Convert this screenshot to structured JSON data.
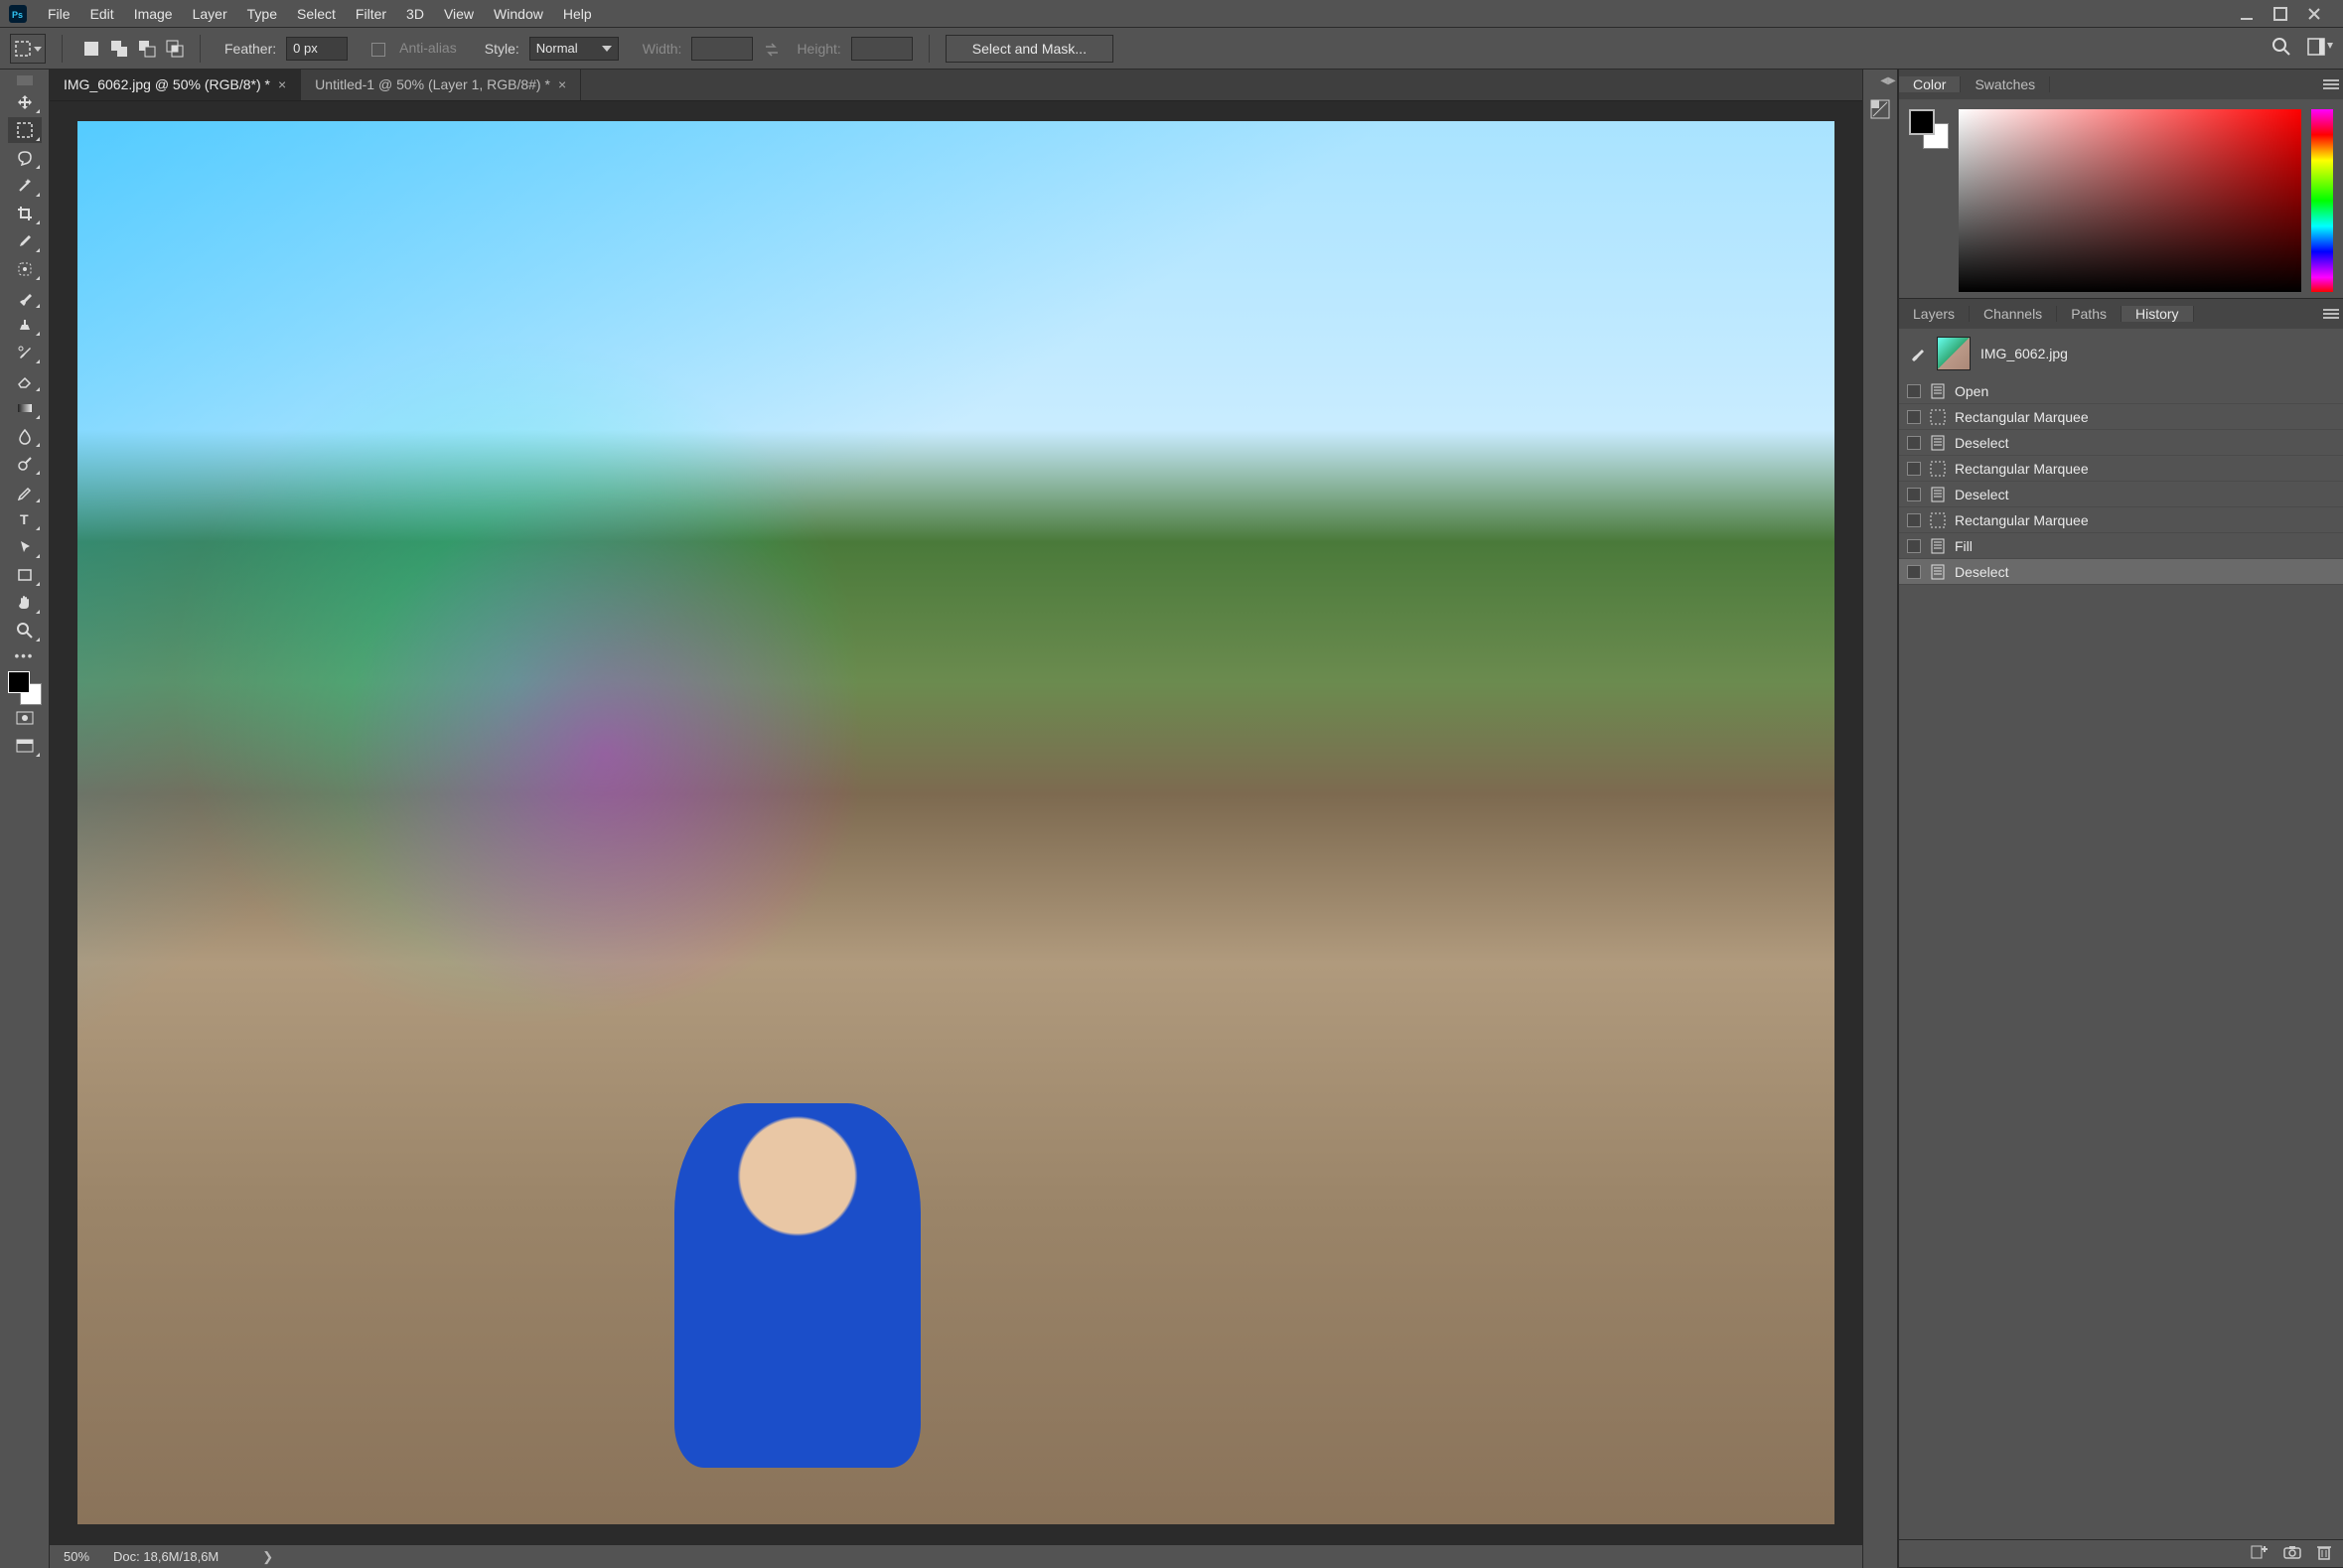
{
  "menubar": {
    "items": [
      "File",
      "Edit",
      "Image",
      "Layer",
      "Type",
      "Select",
      "Filter",
      "3D",
      "View",
      "Window",
      "Help"
    ]
  },
  "optionsbar": {
    "feather_label": "Feather:",
    "feather_value": "0 px",
    "antialias_label": "Anti-alias",
    "style_label": "Style:",
    "style_value": "Normal",
    "width_label": "Width:",
    "width_value": "",
    "height_label": "Height:",
    "height_value": "",
    "select_and_mask": "Select and Mask..."
  },
  "doc_tabs": [
    {
      "label": "IMG_6062.jpg @ 50% (RGB/8*) *",
      "active": true
    },
    {
      "label": "Untitled-1 @ 50% (Layer 1, RGB/8#) *",
      "active": false
    }
  ],
  "statusbar": {
    "zoom": "50%",
    "doc_info": "Doc: 18,6M/18,6M"
  },
  "panels": {
    "color": {
      "tabs": [
        "Color",
        "Swatches"
      ],
      "active_tab": 0
    },
    "history": {
      "tabs": [
        "Layers",
        "Channels",
        "Paths",
        "History"
      ],
      "active_tab": 3,
      "source_name": "IMG_6062.jpg",
      "states": [
        {
          "label": "Open",
          "icon": "document"
        },
        {
          "label": "Rectangular Marquee",
          "icon": "marquee"
        },
        {
          "label": "Deselect",
          "icon": "document"
        },
        {
          "label": "Rectangular Marquee",
          "icon": "marquee"
        },
        {
          "label": "Deselect",
          "icon": "document"
        },
        {
          "label": "Rectangular Marquee",
          "icon": "marquee"
        },
        {
          "label": "Fill",
          "icon": "document"
        },
        {
          "label": "Deselect",
          "icon": "document"
        }
      ],
      "selected_index": 7
    }
  },
  "tools": [
    "move",
    "rectangular-marquee",
    "lasso",
    "magic-wand",
    "crop",
    "eyedropper",
    "spot-heal",
    "brush",
    "clone-stamp",
    "history-brush",
    "eraser",
    "gradient",
    "blur",
    "dodge",
    "pen",
    "type",
    "path-selection",
    "rectangle",
    "hand",
    "zoom"
  ],
  "active_tool_index": 1,
  "colors": {
    "fg": "#000000",
    "bg": "#ffffff"
  }
}
